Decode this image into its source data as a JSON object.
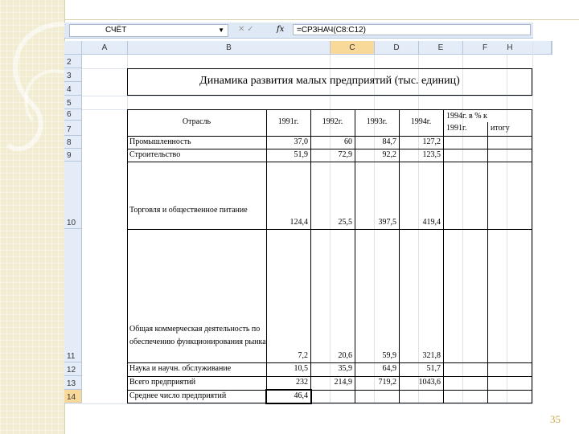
{
  "formula_bar": {
    "name_box": "СЧЁТ",
    "fx": "fx",
    "cancel": "✕ ✓",
    "formula": "=СРЗНАЧ(C8:C12)"
  },
  "columns": [
    "A",
    "B",
    "C",
    "D",
    "E",
    "F",
    "G",
    "H"
  ],
  "rows": [
    "2",
    "3",
    "4",
    "5",
    "6",
    "7",
    "8",
    "9",
    "10",
    "11",
    "12",
    "13",
    "14"
  ],
  "title": "Динамика развития малых предприятий (тыс. единиц)",
  "table": {
    "header": {
      "industry": "Отрасль",
      "y1991": "1991г.",
      "y1992": "1992г.",
      "y1993": "1993г.",
      "y1994": "1994г.",
      "pct_line1": "1994г. в %  к",
      "pct_line2a": "1991г.",
      "pct_line2b": "итогу"
    },
    "rows": [
      {
        "name": "Промышленность",
        "v1991": "37,0",
        "v1992": "60",
        "v1993": "84,7",
        "v1994": "127,2"
      },
      {
        "name": "Строительство",
        "v1991": "51,9",
        "v1992": "72,9",
        "v1993": "92,2",
        "v1994": "123,5"
      },
      {
        "name": "Торговля и общественное питание",
        "v1991": "124,4",
        "v1992": "25,5",
        "v1993": "397,5",
        "v1994": "419,4"
      },
      {
        "name": "Общая коммерческая деятельность по обеспечению функционирования рынка",
        "v1991": "7,2",
        "v1992": "20,6",
        "v1993": "59,9",
        "v1994": "321,8"
      },
      {
        "name": "Наука и научн. обслуживание",
        "v1991": "10,5",
        "v1992": "35,9",
        "v1993": "64,9",
        "v1994": "51,7"
      },
      {
        "name": "Всего предприятий",
        "v1991": "232",
        "v1992": "214,9",
        "v1993": "719,2",
        "v1994": "1043,6"
      },
      {
        "name": "Среднее число предприятий",
        "v1991": "46,4"
      }
    ]
  },
  "page_number": "35"
}
